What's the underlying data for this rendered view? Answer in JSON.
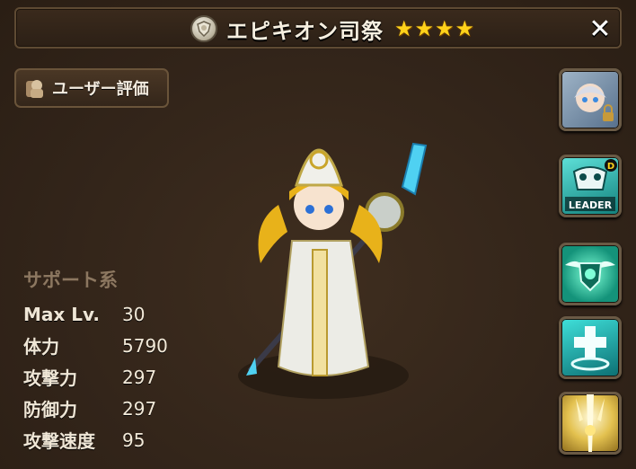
{
  "header": {
    "title": "エピキオン司祭",
    "stars": 4,
    "element_icon": "light-element-icon",
    "close_symbol": "✕"
  },
  "rating_button": {
    "label": "ユーザー評価"
  },
  "stats": {
    "category": "サポート系",
    "rows": [
      {
        "label": "Max Lv.",
        "value": "30"
      },
      {
        "label": "体力",
        "value": "5790"
      },
      {
        "label": "攻撃力",
        "value": "297"
      },
      {
        "label": "防御力",
        "value": "297"
      },
      {
        "label": "攻撃速度",
        "value": "95"
      }
    ]
  },
  "side_buttons": {
    "leader_label": "LEADER",
    "leader_badge": "D",
    "icons": [
      "monster-portrait-icon",
      "leader-skill-icon",
      "skill-wing-shield-icon",
      "skill-heal-cross-icon",
      "skill-light-beam-icon"
    ]
  },
  "colors": {
    "accent": "#ffd21a",
    "panel": "#33251a",
    "border": "#5e4a33"
  }
}
